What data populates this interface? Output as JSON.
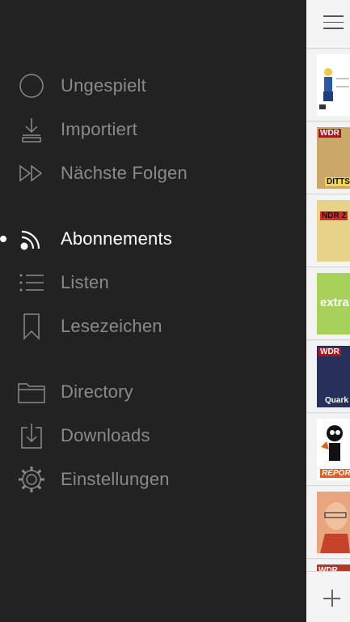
{
  "menu": {
    "items": [
      {
        "label": "Ungespielt",
        "icon": "circle-icon"
      },
      {
        "label": "Importiert",
        "icon": "import-icon"
      },
      {
        "label": "Nächste Folgen",
        "icon": "next-episodes-icon"
      },
      {
        "label": "Abonnements",
        "icon": "subscriptions-feed-icon",
        "active": true
      },
      {
        "label": "Listen",
        "icon": "list-icon"
      },
      {
        "label": "Lesezeichen",
        "icon": "bookmark-icon"
      },
      {
        "label": "Directory",
        "icon": "folder-icon"
      },
      {
        "label": "Downloads",
        "icon": "download-icon"
      },
      {
        "label": "Einstellungen",
        "icon": "gear-icon"
      }
    ]
  },
  "content": {
    "thumbnails": [
      {
        "caption": "",
        "bg": "#ffffff"
      },
      {
        "caption": "WDR",
        "caption2": "DITTS",
        "bg": "#c9a86a"
      },
      {
        "caption": "NDR 2",
        "bg": "#e7d28a"
      },
      {
        "caption": "extra",
        "bg": "#a8d15a"
      },
      {
        "caption": "WDR",
        "caption2": "Quark",
        "bg": "#27305a"
      },
      {
        "caption": "REPOR",
        "bg": "#ffffff"
      },
      {
        "caption": "",
        "bg": "#e8a57e"
      },
      {
        "caption": "WDR",
        "bg": "#b23a2a"
      }
    ]
  },
  "colors": {
    "drawer_bg": "#222222",
    "inactive_text": "#8a8a8a",
    "active_text": "#ffffff",
    "content_bg": "#ececec"
  }
}
